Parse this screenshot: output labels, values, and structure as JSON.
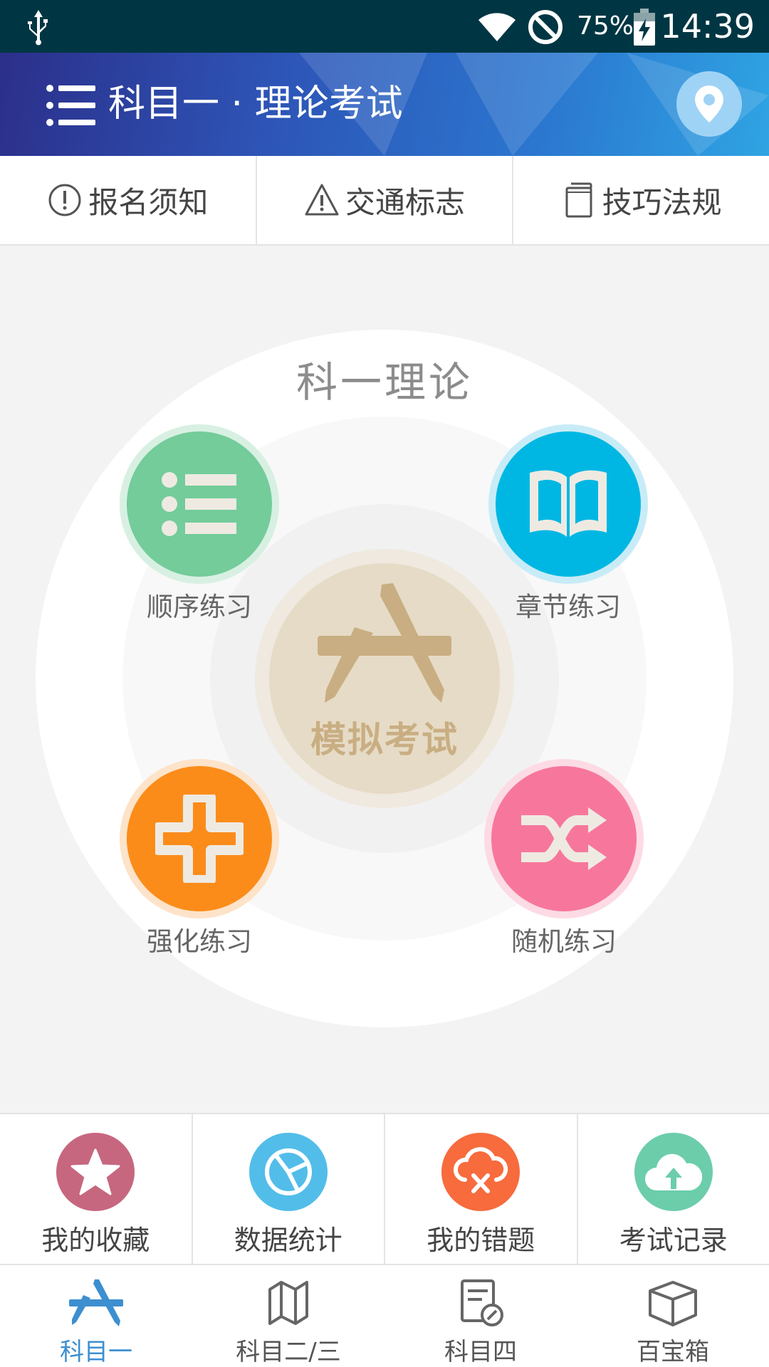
{
  "status_bar": {
    "battery_percent": "75%",
    "time": "14:39"
  },
  "header": {
    "title": "科目一 · 理论考试"
  },
  "top_tabs": [
    {
      "label": "报名须知",
      "icon": "info-circle-icon"
    },
    {
      "label": "交通标志",
      "icon": "warning-triangle-icon"
    },
    {
      "label": "技巧法规",
      "icon": "book-icon"
    }
  ],
  "wheel": {
    "title": "科一理论",
    "center": {
      "label": "模拟考试",
      "icon": "app-store-a-icon",
      "color": "#e6dbc6"
    },
    "practices": [
      {
        "label": "顺序练习",
        "icon": "list-icon",
        "color": "#73cc9a"
      },
      {
        "label": "章节练习",
        "icon": "open-book-icon",
        "color": "#00b7e3"
      },
      {
        "label": "强化练习",
        "icon": "plus-icon",
        "color": "#fb8c1a"
      },
      {
        "label": "随机练习",
        "icon": "shuffle-icon",
        "color": "#f7779c"
      }
    ]
  },
  "quick_actions": [
    {
      "label": "我的收藏",
      "icon": "star-icon",
      "color": "#c6677f"
    },
    {
      "label": "数据统计",
      "icon": "pie-chart-icon",
      "color": "#52bde9"
    },
    {
      "label": "我的错题",
      "icon": "cloud-error-icon",
      "color": "#f76b3d"
    },
    {
      "label": "考试记录",
      "icon": "cloud-upload-icon",
      "color": "#6ccdab"
    }
  ],
  "bottom_nav": [
    {
      "label": "科目一",
      "icon": "app-store-a-icon",
      "active": true
    },
    {
      "label": "科目二/三",
      "icon": "map-icon",
      "active": false
    },
    {
      "label": "科目四",
      "icon": "document-edit-icon",
      "active": false
    },
    {
      "label": "百宝箱",
      "icon": "box-icon",
      "active": false
    }
  ],
  "colors": {
    "accent": "#3d8fd0",
    "statusbar": "#003643"
  }
}
